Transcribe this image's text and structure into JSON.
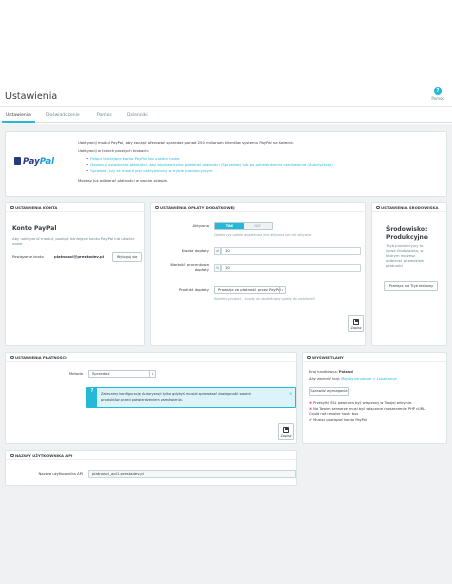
{
  "header": {
    "title": "Ustawienia",
    "help_label": "Pomoc",
    "help_icon": "question-icon",
    "accent": "#25b9d7"
  },
  "tabs": [
    {
      "label": "Ustawienia",
      "active": true
    },
    {
      "label": "Doświadczenie"
    },
    {
      "label": "Pomoc"
    },
    {
      "label": "Dzienniki"
    }
  ],
  "intro": {
    "logo_pay": "Pay",
    "logo_pal": "Pal",
    "line1": "Uaktywnij moduł PayPal, aby zacząć oferować sprzedaż ponad 250 milionom klientów systemu PayPal na świecie.",
    "line2": "Uaktywnij w trzech prostych krokach:",
    "step1": "Połącz istniejące konto PayPal lub utwórz nowe.",
    "step2": "Dostosuj ustawienia płatności, aby błyskawicznie pobierać płatności (Sprzedaż) lub po potwierdzeniu zamówienia (Autoryzacja).",
    "step3": "Sprawdź, czy ze moduł jest uaktywniony w trybie produkcyjnym.",
    "line3": "Możesz już odbierać płatności w swoim sklepie."
  },
  "account": {
    "heading": "Ustawienia konta",
    "title": "Konto PayPal",
    "desc1": "Aby uaktywnić moduł, powiąż istniejące konto PayPal lub utwórz",
    "desc2": "nowe.",
    "linked_label": "Powiązane konto",
    "linked_value": "platnosci@prestadev.pl",
    "unlink_button": "Wyloguj się"
  },
  "extra": {
    "heading": "Ustawienia opłaty dodatkowej",
    "active_label": "Aktywna",
    "yes": "TAK",
    "no": "NIE",
    "active_help": "Opłata czy opłata dodatkowa jest aktywna lub nie aktywna",
    "fee_label": "Kwota dopłaty",
    "fee_addon": "zł",
    "fee_value": "10",
    "pct_label1": "Wartość procentowa",
    "pct_label2": "dopłaty",
    "pct_addon": "%",
    "pct_value": "10",
    "product_label": "Produkt dopłaty",
    "product_value": "Prowizja za płatność przez PayPal",
    "product_help": "Wybierz produkt - koszty do dodatkowej opłaty do zamówień",
    "save_label": "Zapisz"
  },
  "env": {
    "heading": "Ustawienia środowiska",
    "title1": "Środowisko:",
    "title2": "Produkcyjne",
    "desc": [
      "Tryb produkcyjny to",
      "żywe środowisko, w",
      "którym możesz",
      "odbierać prawdziwe",
      "płatności"
    ],
    "button": "Przełącz na Tryb testowy"
  },
  "payment": {
    "heading": "Ustawienia płatności",
    "method_label": "Metoda",
    "method_value": "Sprzedaż",
    "alert1": "Zalecamy konfigurację Autoryzacji tylko gdybyś musiał sprawdzać dostępność swoich",
    "alert2": "produktów przed potwierdzeniem zamówienia.",
    "save_label": "Zapisz"
  },
  "status": {
    "heading": "Wyświetlany",
    "country_label": "Kraj handlowca:",
    "country_value": "Poland",
    "change_text": "Aby zmienić kraj:",
    "change_link": "Międzynarodowe > Lokalizacja",
    "check_button": "Sprawdź wymagania",
    "req1": "Przesyłki SSL powinien być włączony w Twojej witrynie.",
    "req2": "Na Twoim serwerze musi być włączone rozszerzenie PHP cURL.",
    "req3": "Could not resolve host: bus",
    "req4": "Musisz powiązać konto PayPal",
    "error_color": "#e84e6a",
    "ok_color": "#363a41"
  },
  "api": {
    "heading": "Nazwy użytkownika API",
    "label": "Nazwa użytkownika API",
    "value": "platnosci_api1.prestadev.pl"
  }
}
